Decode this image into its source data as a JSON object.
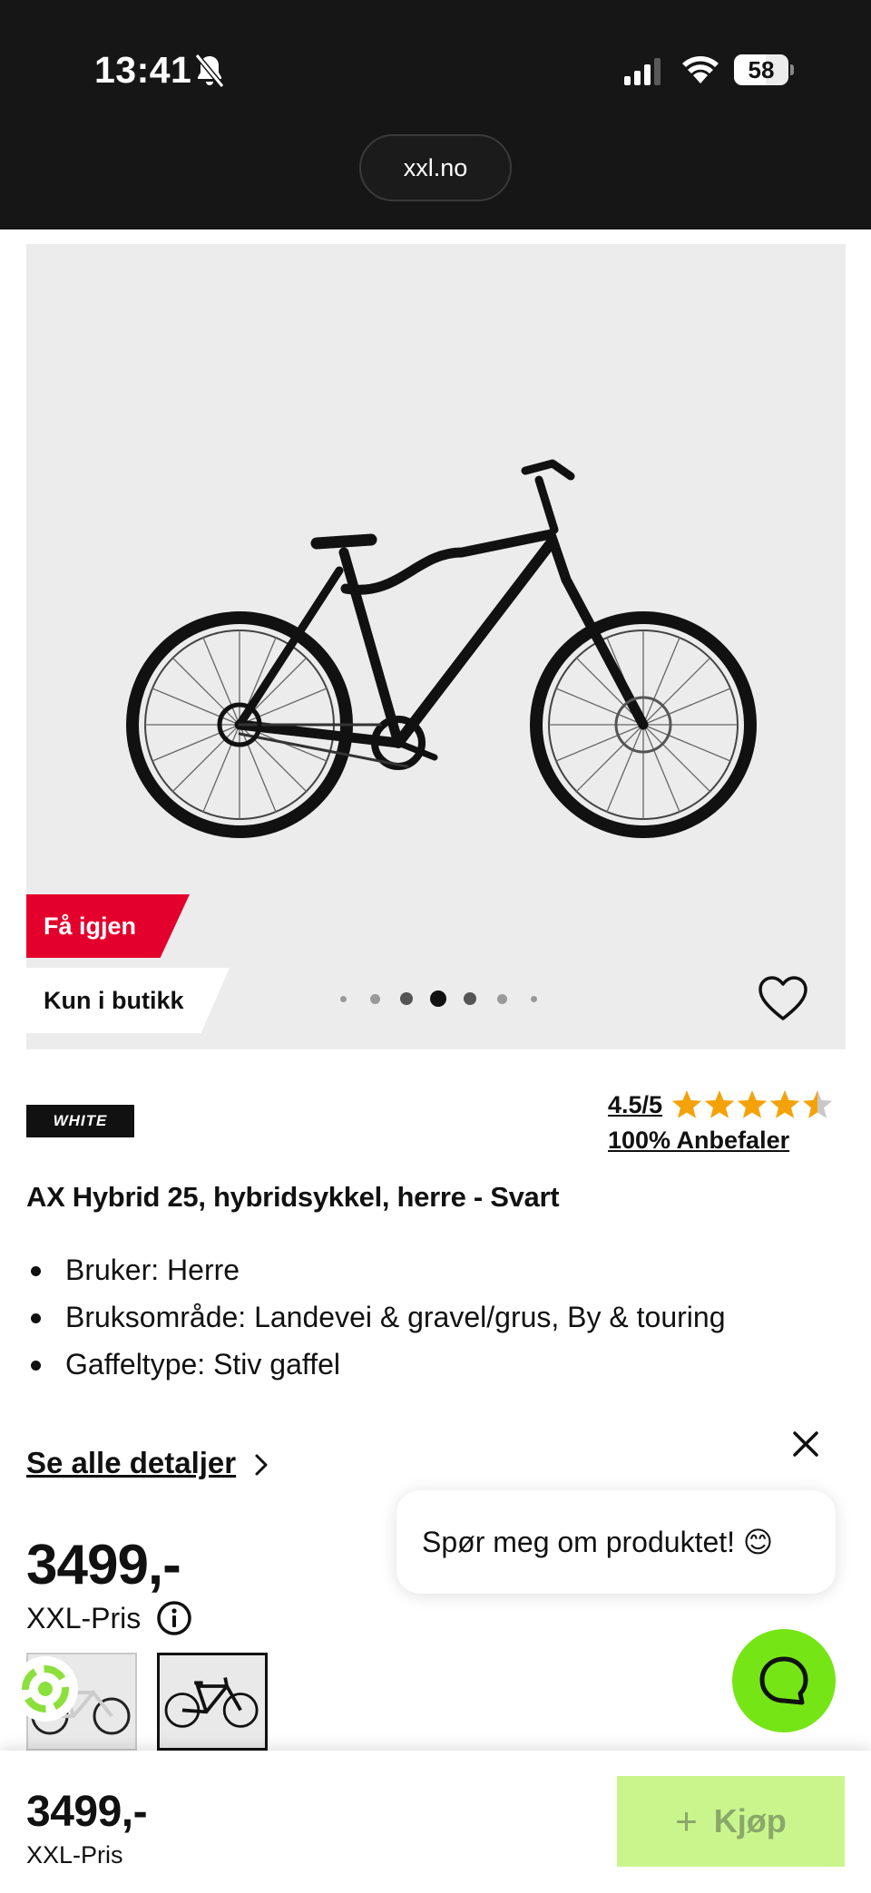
{
  "status_bar": {
    "time": "13:41",
    "battery_level": "58",
    "battery_fraction": 0.58,
    "url": "xxl.no"
  },
  "product_image": {
    "badge_primary": "Få igjen",
    "badge_secondary": "Kun i butikk",
    "carousel": {
      "total": 7,
      "active_index": 3
    },
    "accent_red": "#e3002c"
  },
  "brand": {
    "logo_text": "WHITE"
  },
  "rating": {
    "score_text": "4.5/5",
    "score": 4.5,
    "max": 5,
    "star_color": "#f5a20a",
    "recommend_text": "100% Anbefaler"
  },
  "product": {
    "title": "AX Hybrid 25, hybridsykkel, herre - Svart",
    "bullets": [
      "Bruker: Herre",
      "Bruksområde: Landevei & gravel/grus, By & touring",
      "Gaffeltype: Stiv gaffel"
    ],
    "details_link": "Se alle detaljer"
  },
  "chat": {
    "prompt": "Spør meg om produktet! 😊",
    "fab_color": "#76e515"
  },
  "price": {
    "amount": "3499,-",
    "label": "XXL-Pris"
  },
  "bottom_bar": {
    "price": "3499,-",
    "label": "XXL-Pris",
    "buy_label": "Kjøp",
    "buy_color": "#c9f58c"
  }
}
